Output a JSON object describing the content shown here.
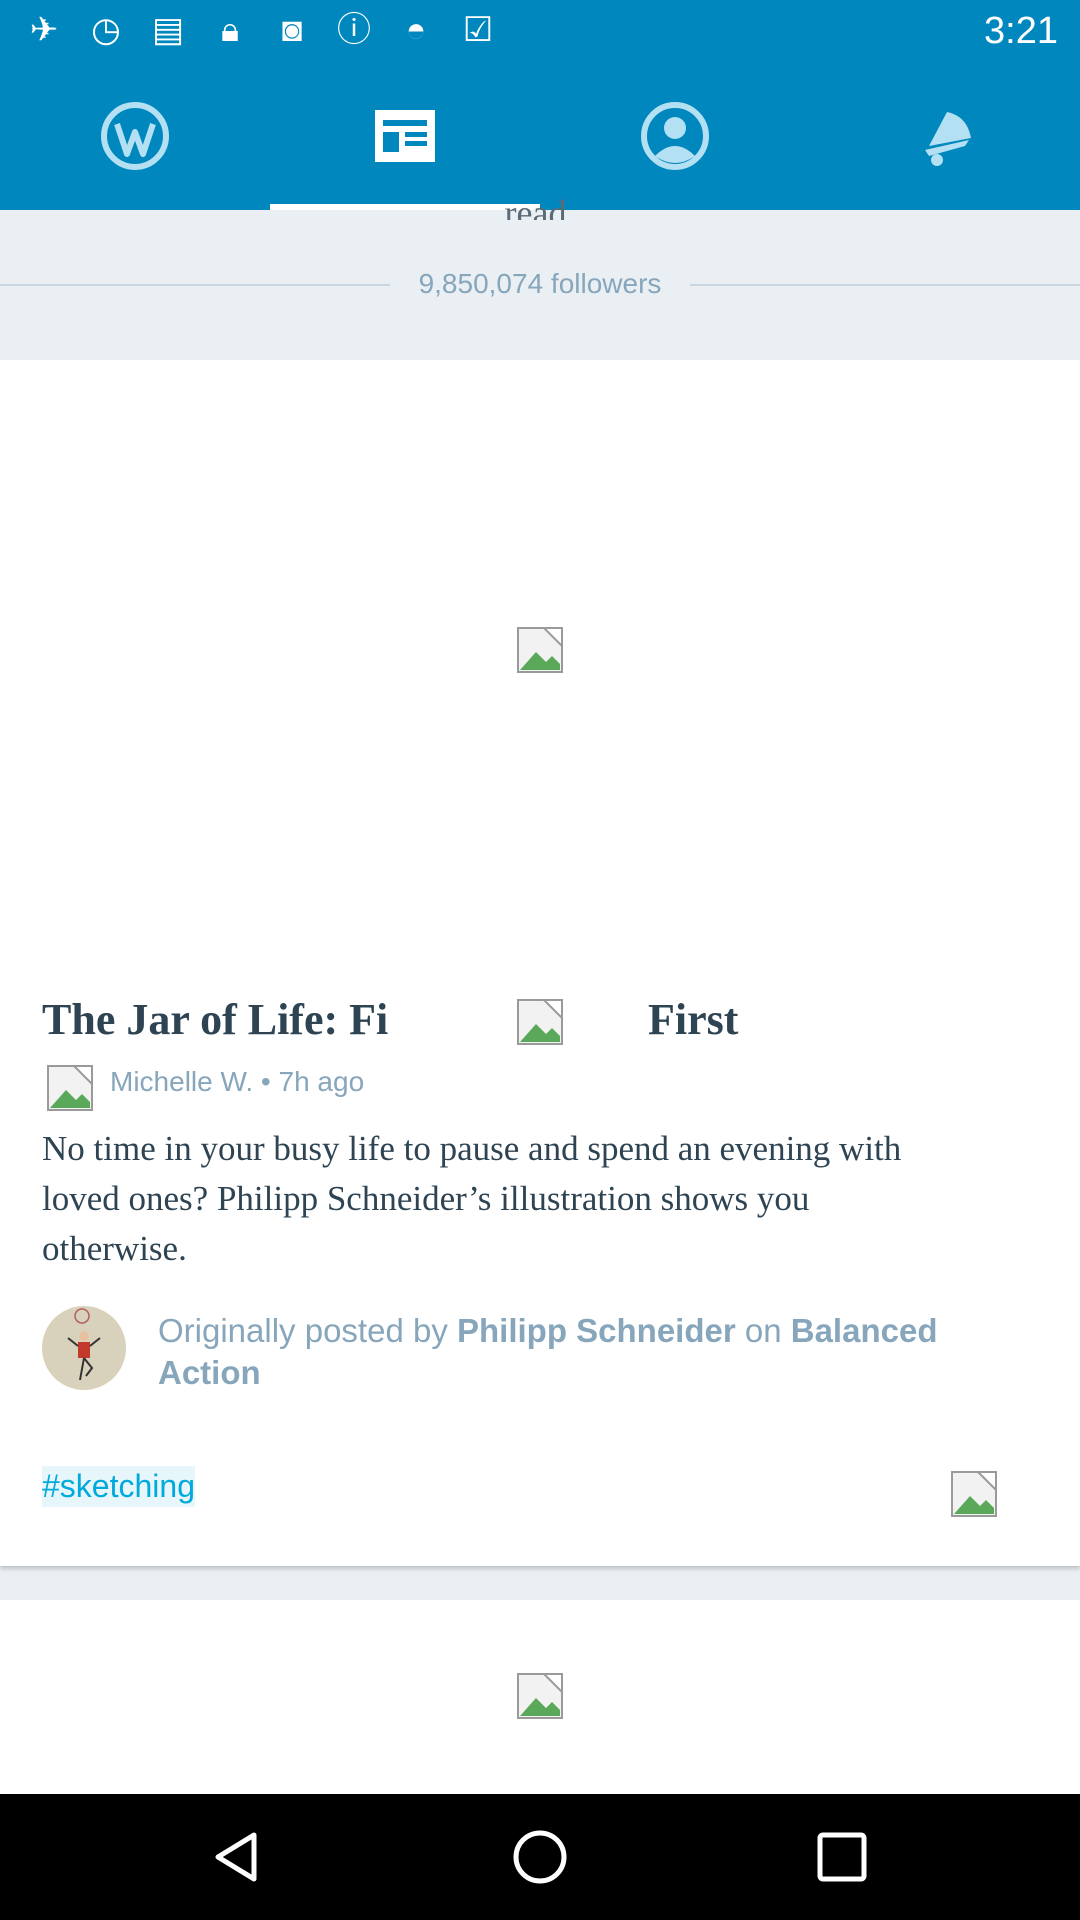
{
  "status_bar": {
    "time": "3:21",
    "icons": [
      "fake-gps-icon",
      "stopwatch-icon",
      "printer-icon",
      "lock-icon",
      "instagram-icon",
      "info-icon",
      "android-icon",
      "clipboard-check-icon"
    ]
  },
  "tabs": [
    {
      "name": "tab-wordpress",
      "icon": "wordpress-icon",
      "selected": false
    },
    {
      "name": "tab-reader",
      "icon": "reader-icon",
      "selected": true
    },
    {
      "name": "tab-me",
      "icon": "profile-icon",
      "selected": false
    },
    {
      "name": "tab-notifications",
      "icon": "bell-icon",
      "selected": false
    }
  ],
  "header": {
    "read_fragment": "read.",
    "followers": "9,850,074 followers"
  },
  "post": {
    "title_start": "The Jar of Life: Fi",
    "title_end": "First",
    "byline": "Michelle W. • 7h ago",
    "excerpt": "No time in your busy life to pause and spend an evening with loved ones? Philipp Schneider’s illustration shows you otherwise.",
    "attribution_prefix": "Originally posted by ",
    "attribution_author": "Philipp Schneider",
    "attribution_mid": " on ",
    "attribution_site": "Balanced Action",
    "tag": "#sketching"
  },
  "colors": {
    "brand_blue": "#0087be",
    "link_blue": "#00aadc",
    "text_dark": "#2e4453",
    "text_muted": "#87a6bc",
    "background": "#e9eff3"
  }
}
